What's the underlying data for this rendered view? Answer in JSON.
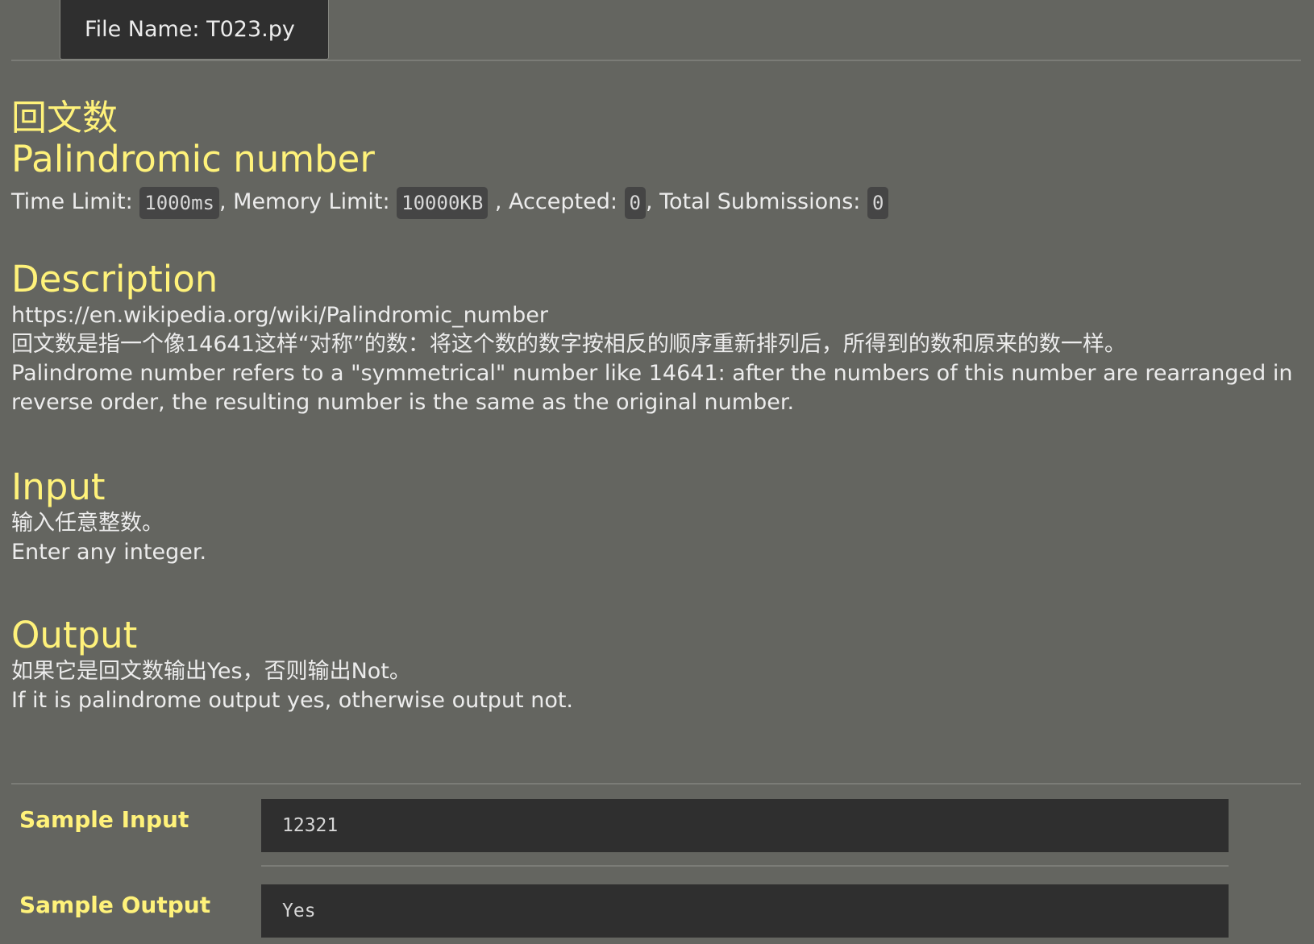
{
  "tab": {
    "label": "File Name:  T023.py"
  },
  "problem": {
    "title_cn": "回文数",
    "title_en": "Palindromic number",
    "limits": {
      "time_label": "Time Limit: ",
      "time_value": "1000ms",
      "memory_label": ", Memory Limit: ",
      "memory_value": "10000KB",
      "accepted_label": " , Accepted: ",
      "accepted_value": "0",
      "submissions_label": ", Total Submissions: ",
      "submissions_value": "0"
    }
  },
  "description": {
    "heading": "Description",
    "lines": [
      "https://en.wikipedia.org/wiki/Palindromic_number",
      "回文数是指一个像14641这样“对称”的数：将这个数的数字按相反的顺序重新排列后，所得到的数和原来的数一样。",
      "Palindrome number refers to a \"symmetrical\" number like 14641: after the numbers of this number are rearranged in reverse order, the resulting number is the same as the original number."
    ]
  },
  "input": {
    "heading": "Input",
    "lines": [
      "输入任意整数。",
      "Enter any integer."
    ]
  },
  "output": {
    "heading": "Output",
    "lines": [
      "如果它是回文数输出Yes，否则输出Not。",
      "If it is palindrome output yes, otherwise output not."
    ]
  },
  "samples": {
    "input_label": "Sample Input",
    "input_value": "12321",
    "output_label": "Sample Output",
    "output_value": "Yes"
  },
  "colors": {
    "background": "#646560",
    "heading_yellow": "#fff27a",
    "dark_panel": "#2f2f2f"
  }
}
